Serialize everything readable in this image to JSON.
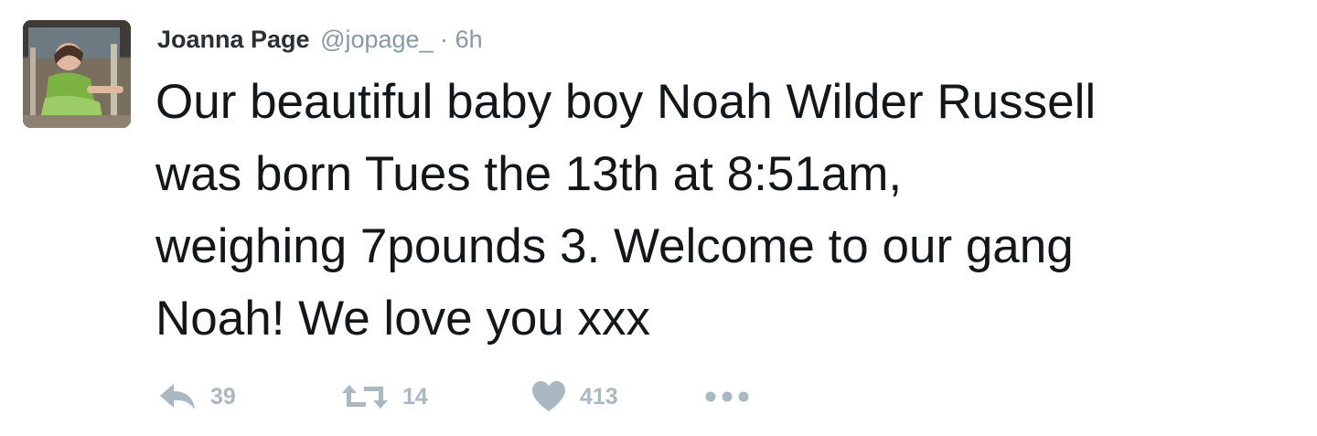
{
  "tweet": {
    "display_name": "Joanna Page",
    "handle": "@jopage_",
    "separator": "·",
    "timestamp": "6h",
    "text_lines": [
      "Our beautiful baby boy Noah Wilder Russell",
      "was born Tues the 13th at 8:51am,",
      "weighing 7pounds 3. Welcome to our gang",
      "Noah! We love you xxx"
    ],
    "actions": {
      "reply": {
        "icon": "reply-icon",
        "count": "39"
      },
      "retweet": {
        "icon": "retweet-icon",
        "count": "14"
      },
      "like": {
        "icon": "heart-icon",
        "count": "413"
      },
      "more": {
        "icon": "more-dots-icon"
      }
    }
  },
  "colors": {
    "text": "#14171a",
    "muted": "#8899a6",
    "action_gray": "#aab8c2"
  }
}
